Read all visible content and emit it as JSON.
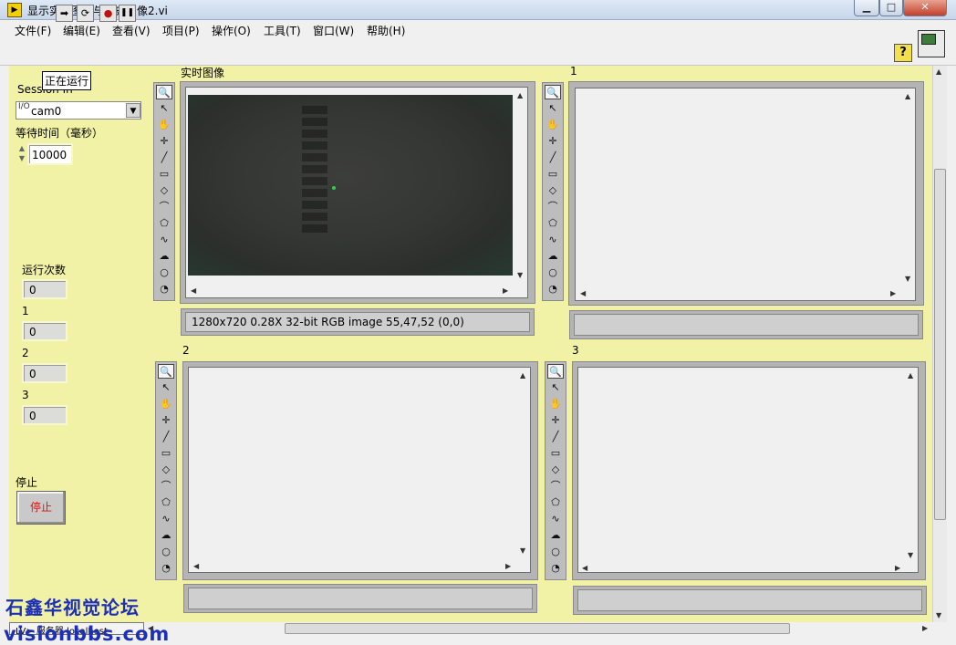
{
  "window": {
    "app_icon": "labview-vi-icon",
    "title": "显示实时图像与历史图像2.vi",
    "controls": {
      "minimize": "▁",
      "maximize": "□",
      "close": "✕"
    }
  },
  "menu": [
    "文件(F)",
    "编辑(E)",
    "查看(V)",
    "项目(P)",
    "操作(O)",
    "工具(T)",
    "窗口(W)",
    "帮助(H)"
  ],
  "toolbar": {
    "run_icon": "➡",
    "run_continuous_icon": "⟳",
    "abort_icon": "●",
    "pause_icon": "❚❚",
    "help_icon": "?",
    "tooltip": "正在运行"
  },
  "left_panel": {
    "session_label": "Session In",
    "session_prefix": "I/O",
    "session_value": "cam0",
    "wait_label": "等待时间（毫秒）",
    "wait_value": "10000",
    "counters": [
      {
        "label": "运行次数",
        "value": "0"
      },
      {
        "label": "1",
        "value": "0"
      },
      {
        "label": "2",
        "value": "0"
      },
      {
        "label": "3",
        "value": "0"
      }
    ],
    "stop_label": "停止",
    "stop_button": "停止"
  },
  "displays": [
    {
      "label": "实时图像",
      "status": "1280x720 0.28X 32-bit RGB image 55,47,52     (0,0)"
    },
    {
      "label": "1",
      "status": ""
    },
    {
      "label": "2",
      "status": ""
    },
    {
      "label": "3",
      "status": ""
    }
  ],
  "palette_icons": [
    "zoom-icon",
    "pointer-icon",
    "pan-hand-icon",
    "crosshair-icon",
    "line-tool-icon",
    "rectangle-tool-icon",
    "rotated-rect-icon",
    "polyline-icon",
    "polygon-icon",
    "freehand-line-icon",
    "freehand-region-icon",
    "oval-tool-icon",
    "annulus-tool-icon"
  ],
  "palette_glyphs": [
    "🔍",
    "↖",
    "✋",
    "✛",
    "╱",
    "▭",
    "◇",
    "⌒",
    "⬠",
    "∿",
    "☁",
    "○",
    "◔"
  ],
  "bottom": {
    "context": "LV> 服务器 localhost",
    "watermark_line1": "石鑫华视觉论坛",
    "watermark_line2": "visionbbs.com"
  }
}
